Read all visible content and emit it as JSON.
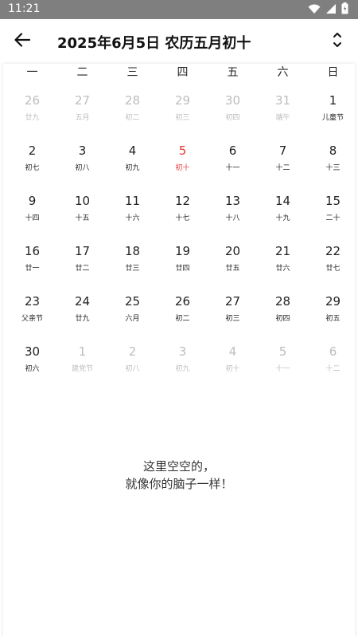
{
  "status_bar": {
    "time": "11:21"
  },
  "header": {
    "title": "2025年6月5日  农历五月初十"
  },
  "weekdays": [
    "一",
    "二",
    "三",
    "四",
    "五",
    "六",
    "日"
  ],
  "days": [
    {
      "n": "26",
      "l": "廿九",
      "s": "muted"
    },
    {
      "n": "27",
      "l": "五月",
      "s": "muted"
    },
    {
      "n": "28",
      "l": "初二",
      "s": "muted"
    },
    {
      "n": "29",
      "l": "初三",
      "s": "muted"
    },
    {
      "n": "30",
      "l": "初四",
      "s": "muted"
    },
    {
      "n": "31",
      "l": "端午",
      "s": "muted"
    },
    {
      "n": "1",
      "l": "儿童节",
      "s": "current"
    },
    {
      "n": "2",
      "l": "初七",
      "s": "current"
    },
    {
      "n": "3",
      "l": "初八",
      "s": "current"
    },
    {
      "n": "4",
      "l": "初九",
      "s": "current"
    },
    {
      "n": "5",
      "l": "初十",
      "s": "today"
    },
    {
      "n": "6",
      "l": "十一",
      "s": "current"
    },
    {
      "n": "7",
      "l": "十二",
      "s": "current"
    },
    {
      "n": "8",
      "l": "十三",
      "s": "current"
    },
    {
      "n": "9",
      "l": "十四",
      "s": "current"
    },
    {
      "n": "10",
      "l": "十五",
      "s": "current"
    },
    {
      "n": "11",
      "l": "十六",
      "s": "current"
    },
    {
      "n": "12",
      "l": "十七",
      "s": "current"
    },
    {
      "n": "13",
      "l": "十八",
      "s": "current"
    },
    {
      "n": "14",
      "l": "十九",
      "s": "current"
    },
    {
      "n": "15",
      "l": "二十",
      "s": "current"
    },
    {
      "n": "16",
      "l": "廿一",
      "s": "current"
    },
    {
      "n": "17",
      "l": "廿二",
      "s": "current"
    },
    {
      "n": "18",
      "l": "廿三",
      "s": "current"
    },
    {
      "n": "19",
      "l": "廿四",
      "s": "current"
    },
    {
      "n": "20",
      "l": "廿五",
      "s": "current"
    },
    {
      "n": "21",
      "l": "廿六",
      "s": "current"
    },
    {
      "n": "22",
      "l": "廿七",
      "s": "current"
    },
    {
      "n": "23",
      "l": "父亲节",
      "s": "current"
    },
    {
      "n": "24",
      "l": "廿九",
      "s": "current"
    },
    {
      "n": "25",
      "l": "六月",
      "s": "current"
    },
    {
      "n": "26",
      "l": "初二",
      "s": "current"
    },
    {
      "n": "27",
      "l": "初三",
      "s": "current"
    },
    {
      "n": "28",
      "l": "初四",
      "s": "current"
    },
    {
      "n": "29",
      "l": "初五",
      "s": "current"
    },
    {
      "n": "30",
      "l": "初六",
      "s": "current"
    },
    {
      "n": "1",
      "l": "建党节",
      "s": "muted"
    },
    {
      "n": "2",
      "l": "初八",
      "s": "muted"
    },
    {
      "n": "3",
      "l": "初九",
      "s": "muted"
    },
    {
      "n": "4",
      "l": "初十",
      "s": "muted"
    },
    {
      "n": "5",
      "l": "十一",
      "s": "muted"
    },
    {
      "n": "6",
      "l": "十二",
      "s": "muted"
    }
  ],
  "empty_state": {
    "line1": "这里空空的，",
    "line2": "就像你的脑子一样！"
  },
  "colors": {
    "status_bar": "#7f7f7f",
    "today": "#e53935",
    "muted": "#bdbdbd"
  },
  "icons": {
    "back": "arrow-left-icon",
    "toggle": "expand-collapse-icon",
    "wifi": "wifi-icon",
    "signal": "signal-icon",
    "battery": "battery-icon"
  }
}
